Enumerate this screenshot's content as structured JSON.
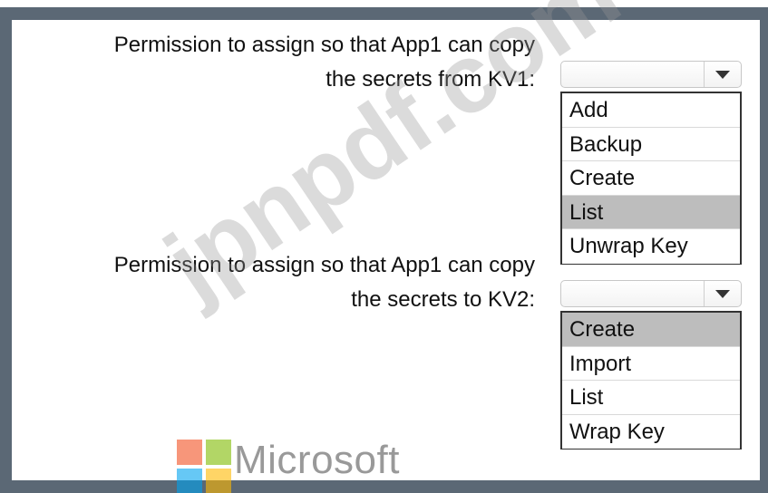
{
  "question": {
    "prompt1_line1": "Permission to assign so that App1 can copy",
    "prompt1_line2": "the secrets from KV1:",
    "prompt2_line1": "Permission to assign so that App1 can copy",
    "prompt2_line2": "the secrets to KV2:"
  },
  "dropdown1": {
    "selected_value": "",
    "options": [
      "Add",
      "Backup",
      "Create",
      "List",
      "Unwrap Key"
    ],
    "highlighted_option": "List"
  },
  "dropdown2": {
    "selected_value": "",
    "options": [
      "Create",
      "Import",
      "List",
      "Wrap Key"
    ],
    "highlighted_option": "Create"
  },
  "watermark": {
    "text": "jpnpdf.com"
  },
  "brand": {
    "name": "Microsoft"
  },
  "colors": {
    "frame": "#5b6875",
    "selected_option": "#bdbdbd",
    "option_border": "#333333"
  },
  "icons": {
    "dropdown_arrow": "chevron-down-icon",
    "logo": "microsoft-logo-icon"
  }
}
